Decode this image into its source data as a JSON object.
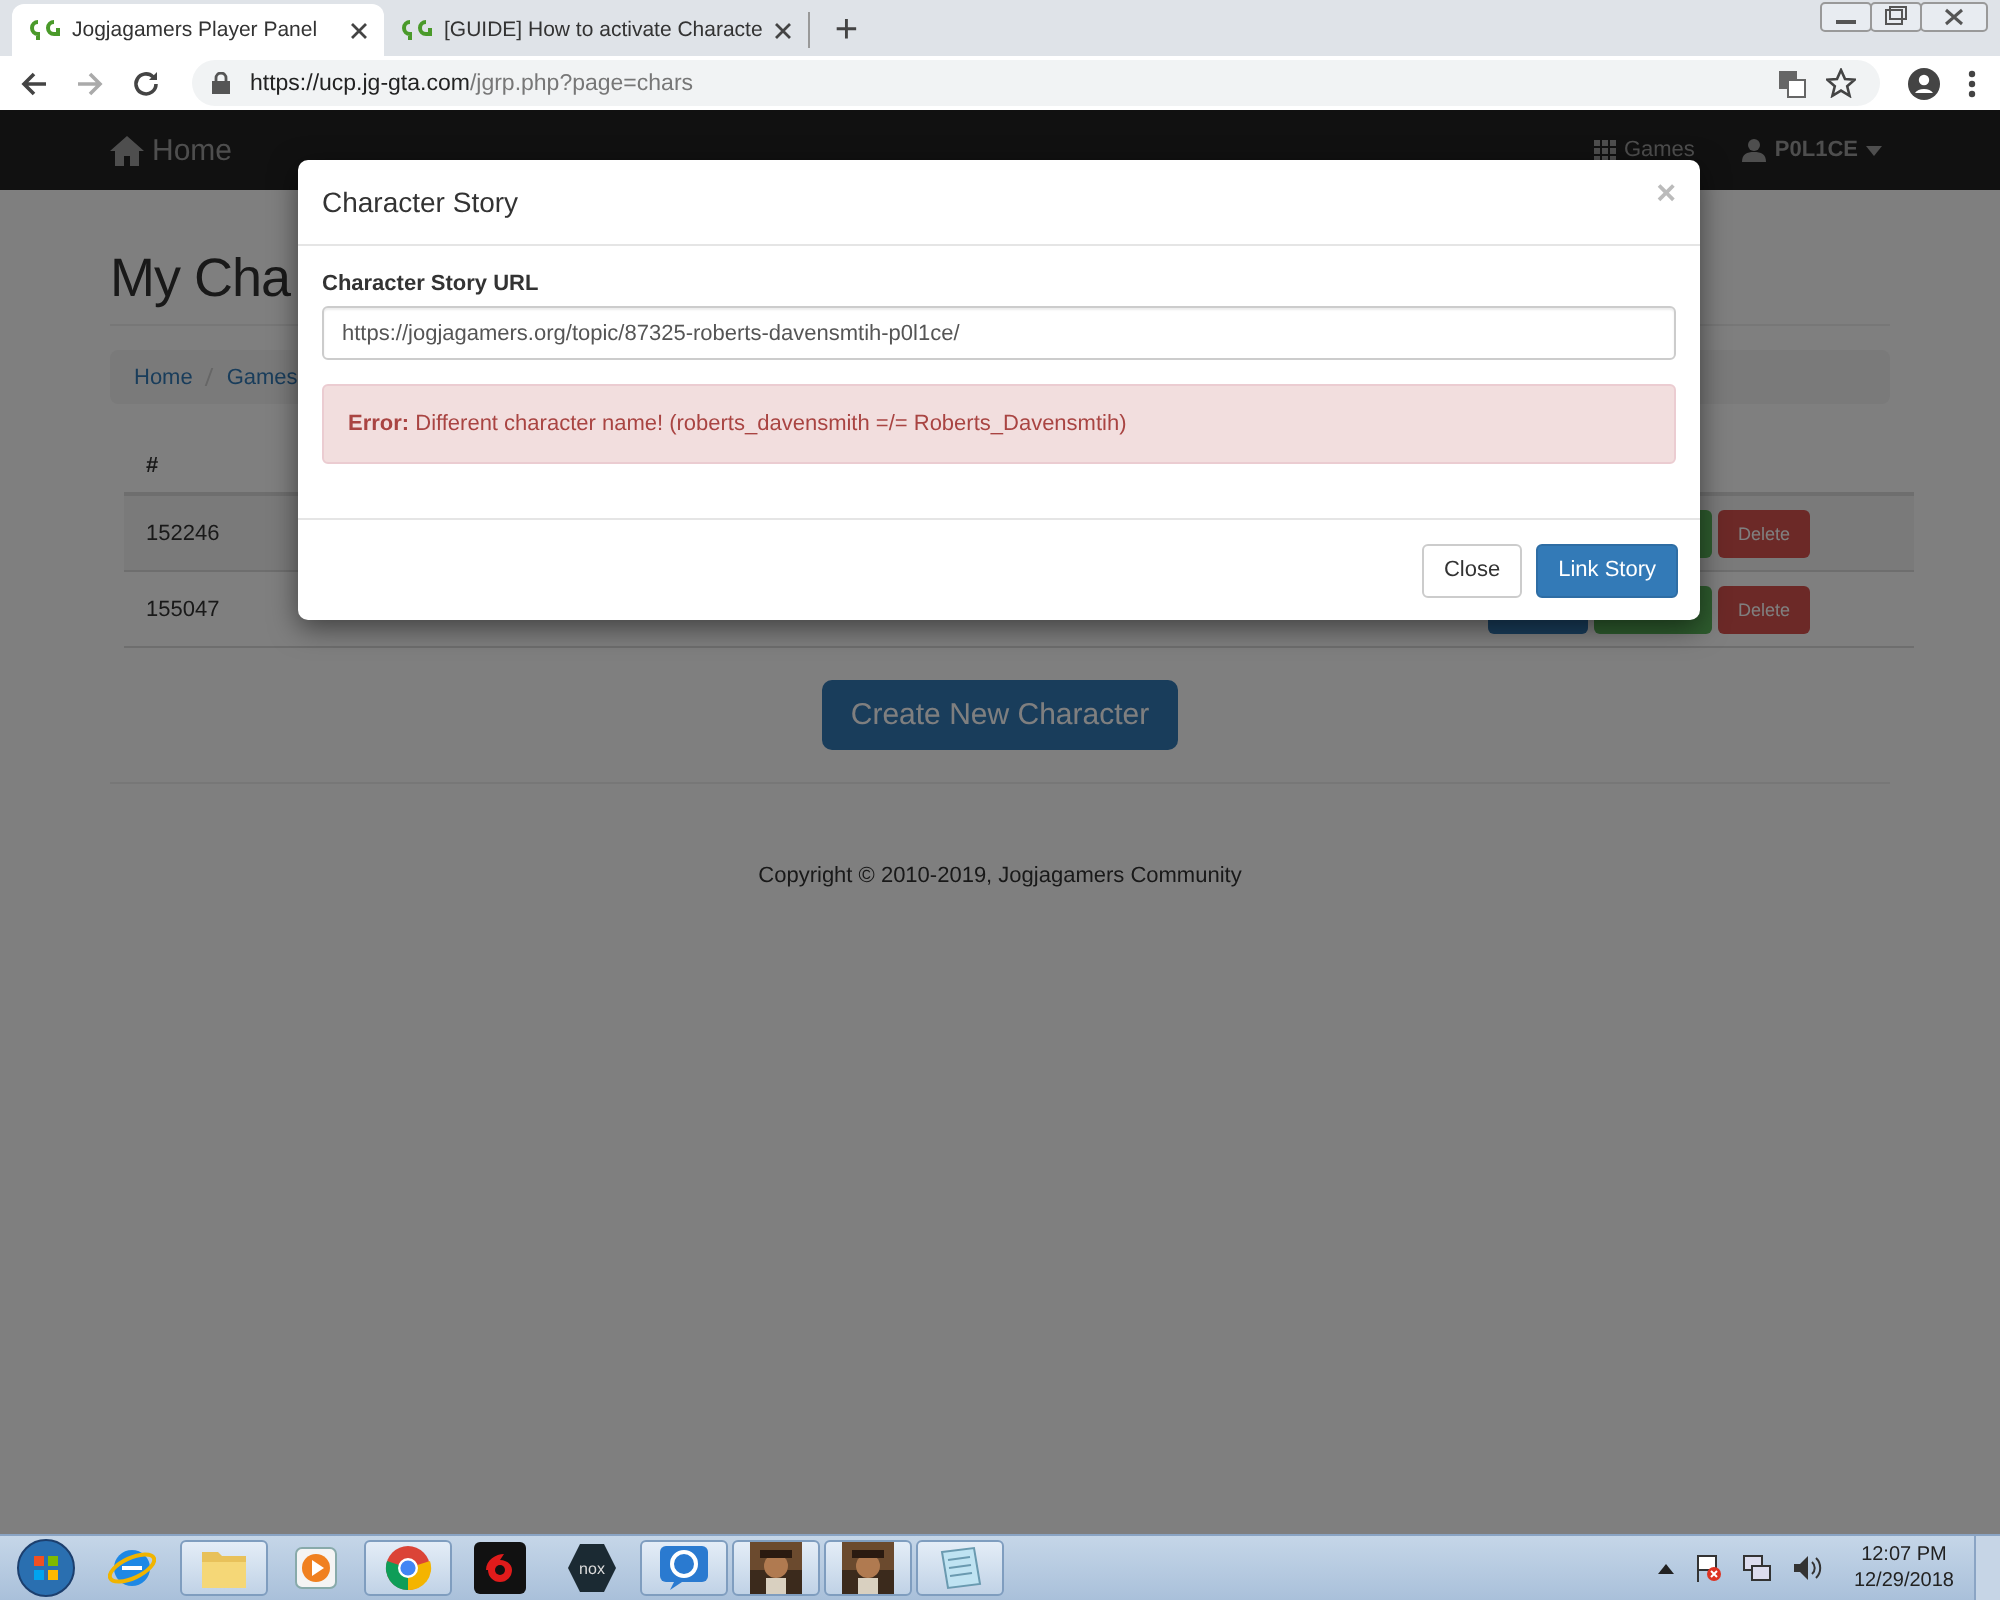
{
  "browser": {
    "tabs": [
      {
        "title": "Jogjagamers Player Panel",
        "selected": true
      },
      {
        "title": "[GUIDE] How to activate Characte",
        "selected": false
      }
    ],
    "new_tab": "+",
    "url_host": "https://ucp.jg-gta.com",
    "url_path": "/jgrp.php?page=chars"
  },
  "navbar": {
    "brand": "Home",
    "links": [
      "Games"
    ],
    "user": "P0L1CE"
  },
  "page": {
    "title": "My Cha",
    "breadcrumb": [
      "Home",
      "Games"
    ],
    "table": {
      "columns": [
        "#"
      ],
      "rows": [
        {
          "id": "152246",
          "action": "Delete"
        },
        {
          "id": "155047",
          "action": "Delete"
        }
      ]
    },
    "create_button": "Create New Character",
    "footer": "Copyright © 2010-2019, Jogjagamers Community"
  },
  "modal": {
    "title": "Character Story",
    "close": "×",
    "label": "Character Story URL",
    "value": "https://jogjagamers.org/topic/87325-roberts-davensmtih-p0l1ce/",
    "alert": "**Error:** Different character name! (roberts_davensmith =/= Roberts_Davensmtih)",
    "buttons": [
      {
        "label": "Close",
        "kind": "default"
      },
      {
        "label": "Link Story",
        "kind": "primary"
      }
    ]
  },
  "taskbar": {
    "items": [
      {
        "kind": "ie",
        "running": false
      },
      {
        "kind": "folder",
        "running": true
      },
      {
        "kind": "media",
        "running": false
      },
      {
        "kind": "chrome",
        "running": true
      },
      {
        "kind": "garena",
        "running": false
      },
      {
        "kind": "nox",
        "running": false,
        "label": "nox"
      },
      {
        "kind": "chat",
        "running": true
      },
      {
        "kind": "picture",
        "running": true
      },
      {
        "kind": "picture",
        "running": true
      },
      {
        "kind": "notepad",
        "running": true
      }
    ],
    "time": "12:07 PM",
    "date": "12/29/2018"
  }
}
